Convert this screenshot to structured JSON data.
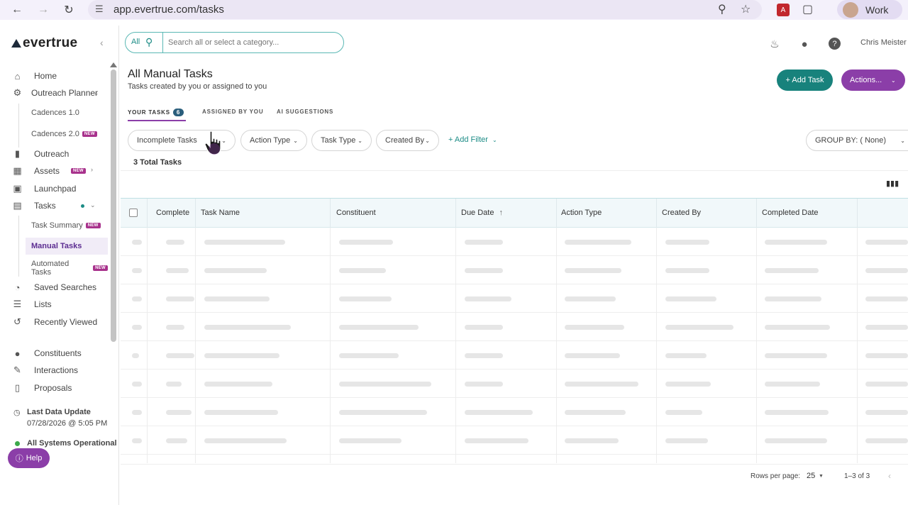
{
  "browser": {
    "url": "app.evertrue.com/tasks",
    "profile_label": "Work"
  },
  "sidebar": {
    "logo": "evertrue",
    "items": [
      {
        "label": "Home"
      },
      {
        "label": "Outreach Planner"
      },
      {
        "label": "Cadences 1.0"
      },
      {
        "label": "Cadences 2.0",
        "badge": "NEW"
      },
      {
        "label": "Outreach"
      },
      {
        "label": "Assets",
        "badge": "NEW"
      },
      {
        "label": "Launchpad"
      },
      {
        "label": "Tasks"
      },
      {
        "label": "Task Summary",
        "badge": "NEW"
      },
      {
        "label": "Manual Tasks"
      },
      {
        "label": "Automated Tasks",
        "badge": "NEW"
      },
      {
        "label": "Saved Searches"
      },
      {
        "label": "Lists"
      },
      {
        "label": "Recently Viewed"
      },
      {
        "label": "Constituents"
      },
      {
        "label": "Interactions"
      },
      {
        "label": "Proposals"
      }
    ],
    "last_update_label": "Last Data Update",
    "last_update_value": "07/28/2026 @ 5:05 PM",
    "status": "All Systems Operational",
    "help": "Help"
  },
  "topbar": {
    "search_scope": "All",
    "search_placeholder": "Search all or select a category...",
    "user_name": "Chris Meister"
  },
  "page": {
    "title": "All Manual Tasks",
    "subtitle": "Tasks created by you or assigned to you",
    "add_task": "+ Add Task",
    "actions": "Actions...",
    "tabs": [
      {
        "label": "YOUR TASKS",
        "count": "6"
      },
      {
        "label": "ASSIGNED BY YOU"
      },
      {
        "label": "AI SUGGESTIONS"
      }
    ],
    "filters": [
      "Incomplete Tasks",
      "Action Type",
      "Task Type",
      "Created By"
    ],
    "add_filter": "+ Add Filter",
    "group_by": "GROUP BY: ( None)",
    "total": "3 Total Tasks"
  },
  "table": {
    "columns": [
      "Complete",
      "Task Name",
      "Constituent",
      "Due Date",
      "Action Type",
      "Created By",
      "Completed Date"
    ],
    "sort_column": "Due Date",
    "loading_rows": 8
  },
  "pagination": {
    "rows_per_page_label": "Rows per page:",
    "rows_per_page": "25",
    "range": "1–3 of 3"
  },
  "colors": {
    "teal": "#18827c",
    "purple": "#8b3ea8",
    "new_badge": "#a8328c"
  }
}
